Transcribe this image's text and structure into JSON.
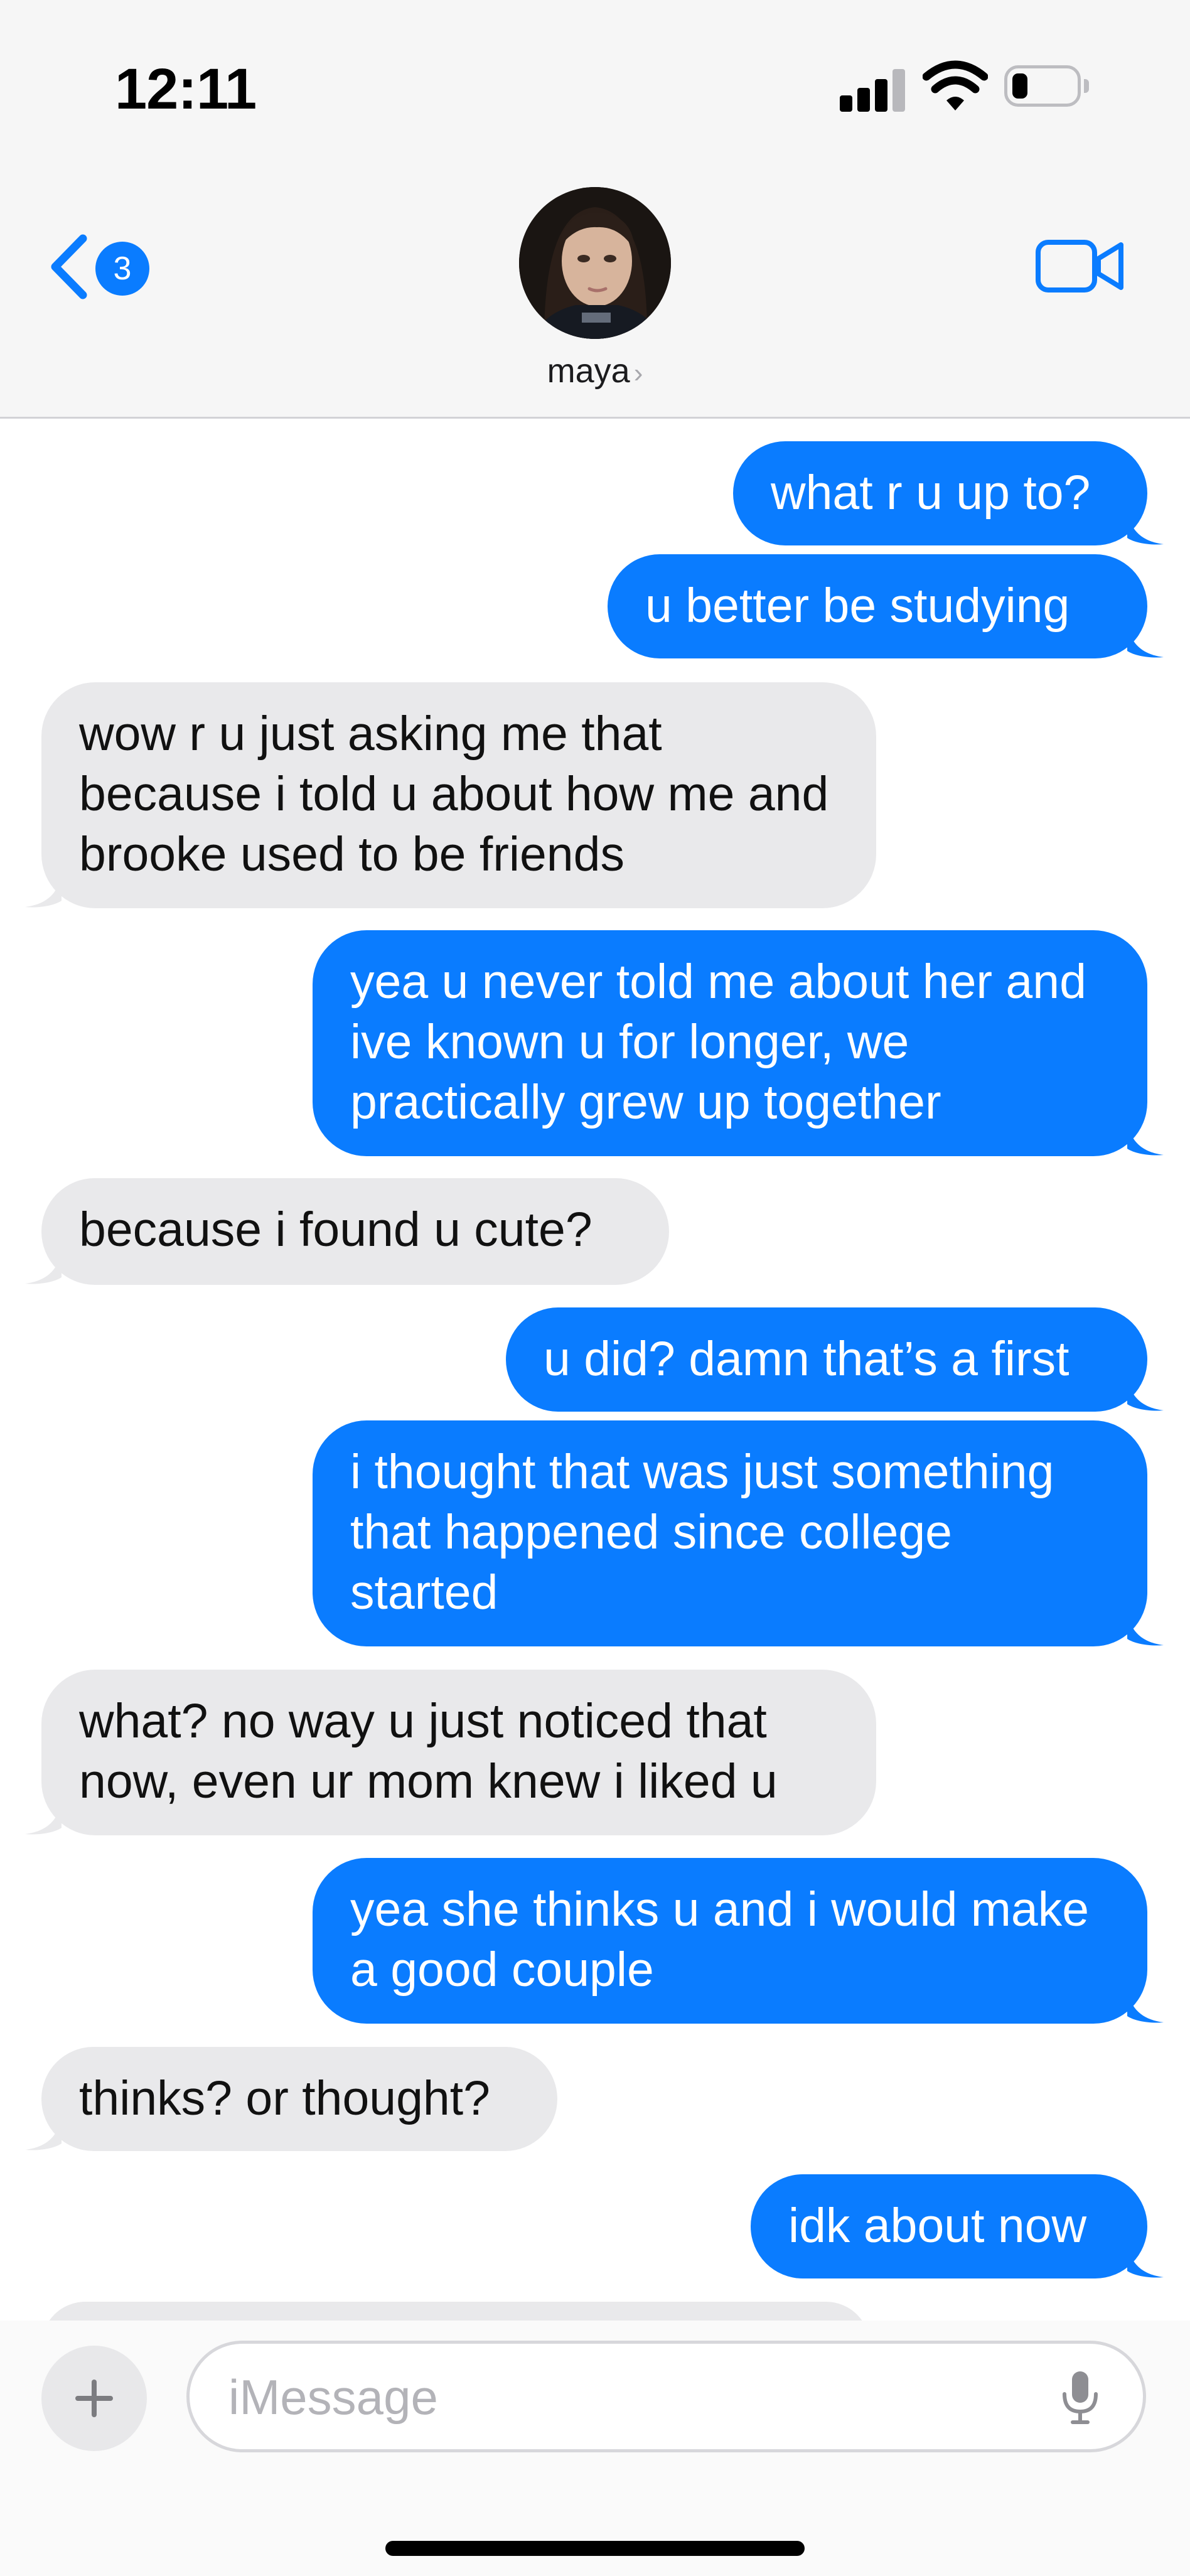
{
  "status_bar": {
    "time": "12:11"
  },
  "header": {
    "unread_count": "3",
    "contact_name": "maya",
    "contact_chevron": "›",
    "icons": {
      "back": "chevron-left-icon",
      "video": "video-camera-icon"
    }
  },
  "messages": [
    {
      "from": "me",
      "text": "what r u up to?"
    },
    {
      "from": "me",
      "text": "u better be studying"
    },
    {
      "from": "them",
      "text": "wow r u just asking me that because i told u about how me and brooke used to be friends"
    },
    {
      "from": "me",
      "text": "yea u never told me about her and ive known u for longer, we practically grew up together"
    },
    {
      "from": "them",
      "text": "because i found u cute?"
    },
    {
      "from": "me",
      "text": "u did? damn that’s a first"
    },
    {
      "from": "me",
      "text": "i thought that was just something that happened since college started"
    },
    {
      "from": "them",
      "text": "what? no way u just noticed that now, even ur mom knew i liked u"
    },
    {
      "from": "me",
      "text": "yea she thinks u and i would make a good couple"
    },
    {
      "from": "them",
      "text": "thinks? or thought?"
    },
    {
      "from": "me",
      "text": "idk about now"
    }
  ],
  "composer": {
    "placeholder": "iMessage",
    "value": "",
    "icons": {
      "add": "plus-icon",
      "dictation": "microphone-icon"
    }
  },
  "colors": {
    "sent_bubble": "#0a7cff",
    "received_bubble": "#e9e9eb",
    "accent": "#0a7cff"
  }
}
